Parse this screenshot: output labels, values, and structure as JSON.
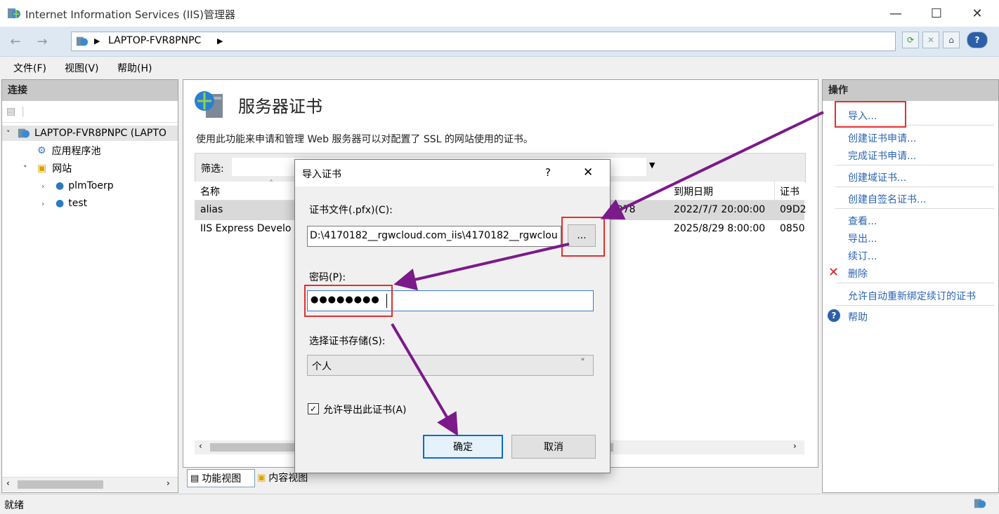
{
  "window": {
    "title": "Internet Information Services (IIS)管理器",
    "minimize": "—",
    "maximize": "☐",
    "close": "✕"
  },
  "address": {
    "crumb": "LAPTOP-FVR8PNPC",
    "sep1": "▶",
    "sep2": "▶"
  },
  "menu": {
    "file": "文件(F)",
    "view": "视图(V)",
    "help": "帮助(H)"
  },
  "connections": {
    "title": "连接",
    "tree": {
      "server": "LAPTOP-FVR8PNPC (LAPTO",
      "app_pool": "应用程序池",
      "sites": "网站",
      "site1": "plmToerp",
      "site2": "test"
    }
  },
  "center": {
    "title": "服务器证书",
    "description": "使用此功能来申请和管理 Web 服务器可以对配置了 SSL 的网站使用的证书。",
    "filter_label": "筛选:",
    "columns": {
      "name": "名称",
      "expires": "到期日期",
      "cert": "证书哈"
    },
    "rows": [
      {
        "name": "alias",
        "partial": "2D78",
        "expires": "2022/7/7 20:00:00",
        "cert": "09D2"
      },
      {
        "name": "IIS Express Develo",
        "partial": "",
        "expires": "2025/8/29 8:00:00",
        "cert": "0850"
      }
    ],
    "tab_features": "功能视图",
    "tab_content": "内容视图"
  },
  "actions": {
    "title": "操作",
    "import": "导入...",
    "create_request": "创建证书申请...",
    "complete_request": "完成证书申请...",
    "create_domain": "创建域证书...",
    "create_selfsigned": "创建自签名证书...",
    "view": "查看...",
    "export": "导出...",
    "renew": "续订...",
    "delete": "删除",
    "auto_rebind": "允许自动重新绑定续订的证书",
    "help": "帮助"
  },
  "dialog": {
    "title": "导入证书",
    "help_btn": "?",
    "close_btn": "✕",
    "file_label": "证书文件(.pfx)(C):",
    "file_value": "D:\\4170182__rgwcloud.com_iis\\4170182__rgwclou",
    "browse_btn": "...",
    "password_label": "密码(P):",
    "password_value": "●●●●●●●●",
    "store_label": "选择证书存储(S):",
    "store_value": "个人",
    "exportable_label": "允许导出此证书(A)",
    "exportable_checked": "✓",
    "ok": "确定",
    "cancel": "取消"
  },
  "status": {
    "text": "就绪"
  },
  "colors": {
    "accent_link": "#2a64b4",
    "annotation_red": "#e03030",
    "annotation_arrow": "#7b1a8a"
  }
}
